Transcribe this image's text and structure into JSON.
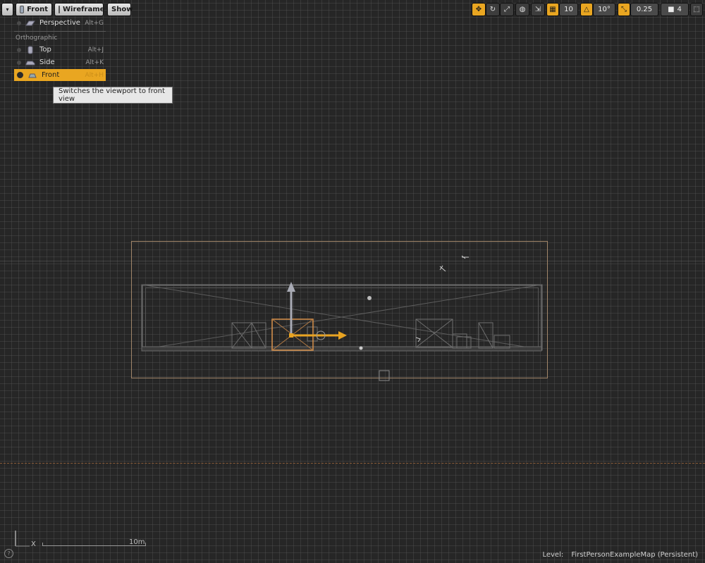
{
  "viewport": {
    "menu_button_label": "",
    "view_mode_label": "Front",
    "render_mode_label": "Wireframe",
    "show_label": "Show"
  },
  "view_menu": {
    "perspective": {
      "label": "Perspective",
      "shortcut": "Alt+G",
      "icon": "perspective-icon"
    },
    "orthographic_header": "Orthographic",
    "items": [
      {
        "label": "Top",
        "shortcut": "Alt+J",
        "icon": "top-view-icon"
      },
      {
        "label": "Side",
        "shortcut": "Alt+K",
        "icon": "side-view-icon"
      },
      {
        "label": "Front",
        "shortcut": "Alt+H",
        "icon": "front-view-icon",
        "selected": true
      }
    ]
  },
  "tooltip": "Switches the viewport to front view",
  "toolbar": {
    "grid_snap_value": "10",
    "rotation_snap_value": "10°",
    "scale_snap_value": "0.25",
    "camera_speed_value": "4",
    "accent_color": "#e9a621"
  },
  "scale_bar": {
    "label": "10m",
    "axis_label": "X"
  },
  "status": {
    "level_label": "Level:",
    "level_value": "FirstPersonExampleMap (Persistent)"
  }
}
